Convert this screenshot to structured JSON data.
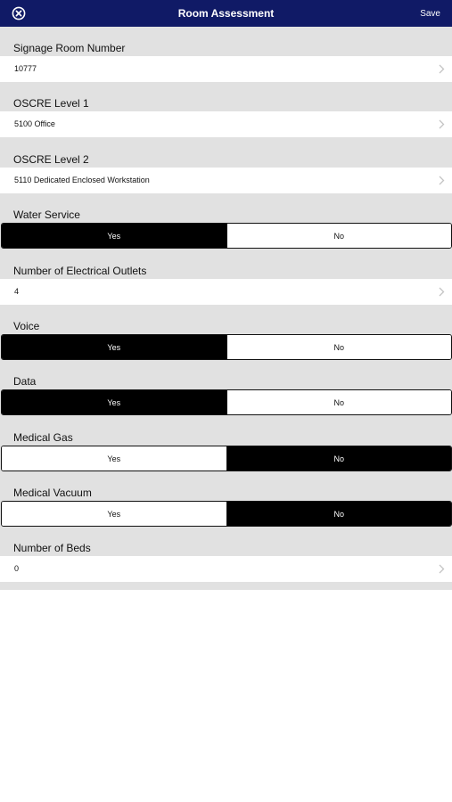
{
  "navbar": {
    "title": "Room Assessment",
    "save_label": "Save",
    "close_icon": "close-circle-icon",
    "bg_color": "#101a66"
  },
  "fields": {
    "signage_room_number": {
      "label": "Signage Room Number",
      "value": "10777"
    },
    "oscre_level_1": {
      "label": "OSCRE Level 1",
      "value": "5100 Office"
    },
    "oscre_level_2": {
      "label": "OSCRE Level 2",
      "value": "5110 Dedicated Enclosed Workstation"
    },
    "water_service": {
      "label": "Water Service",
      "yes": "Yes",
      "no": "No",
      "selected": "Yes"
    },
    "electrical_outlets": {
      "label": "Number of Electrical Outlets",
      "value": "4"
    },
    "voice": {
      "label": "Voice",
      "yes": "Yes",
      "no": "No",
      "selected": "Yes"
    },
    "data": {
      "label": "Data",
      "yes": "Yes",
      "no": "No",
      "selected": "Yes"
    },
    "medical_gas": {
      "label": "Medical Gas",
      "yes": "Yes",
      "no": "No",
      "selected": "No"
    },
    "medical_vacuum": {
      "label": "Medical Vacuum",
      "yes": "Yes",
      "no": "No",
      "selected": "No"
    },
    "number_of_beds": {
      "label": "Number of Beds",
      "value": "0"
    }
  }
}
